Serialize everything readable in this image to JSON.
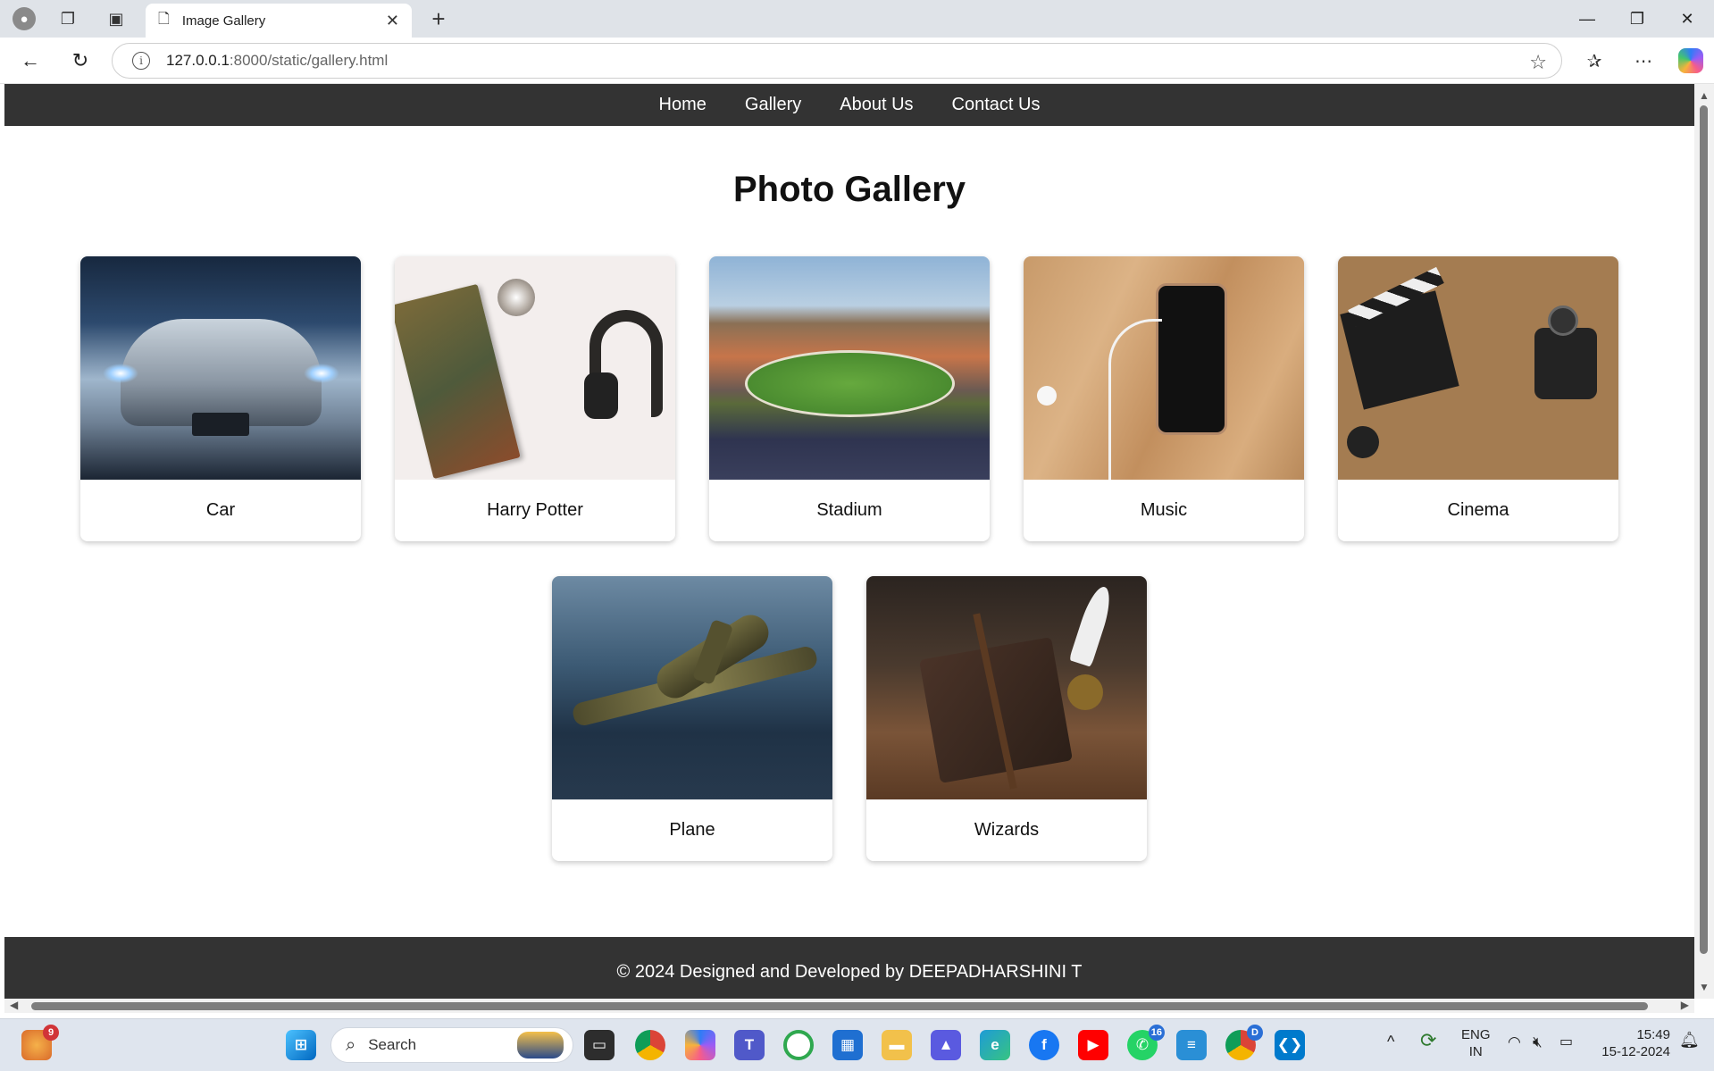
{
  "browser": {
    "tab_title": "Image Gallery",
    "url_host": "127.0.0.1",
    "url_path": ":8000/static/gallery.html"
  },
  "site": {
    "nav": [
      "Home",
      "Gallery",
      "About Us",
      "Contact Us"
    ],
    "page_title": "Photo Gallery",
    "gallery": [
      {
        "caption": "Car"
      },
      {
        "caption": "Harry Potter"
      },
      {
        "caption": "Stadium"
      },
      {
        "caption": "Music"
      },
      {
        "caption": "Cinema"
      },
      {
        "caption": "Plane"
      },
      {
        "caption": "Wizards"
      }
    ],
    "footer": "© 2024 Designed and Developed by DEEPADHARSHINI T"
  },
  "taskbar": {
    "search_placeholder": "Search",
    "weather_badge": "9",
    "whatsapp_badge": "16",
    "chrome_badge": "D",
    "lang_top": "ENG",
    "lang_bottom": "IN",
    "time": "15:49",
    "date": "15-12-2024"
  }
}
